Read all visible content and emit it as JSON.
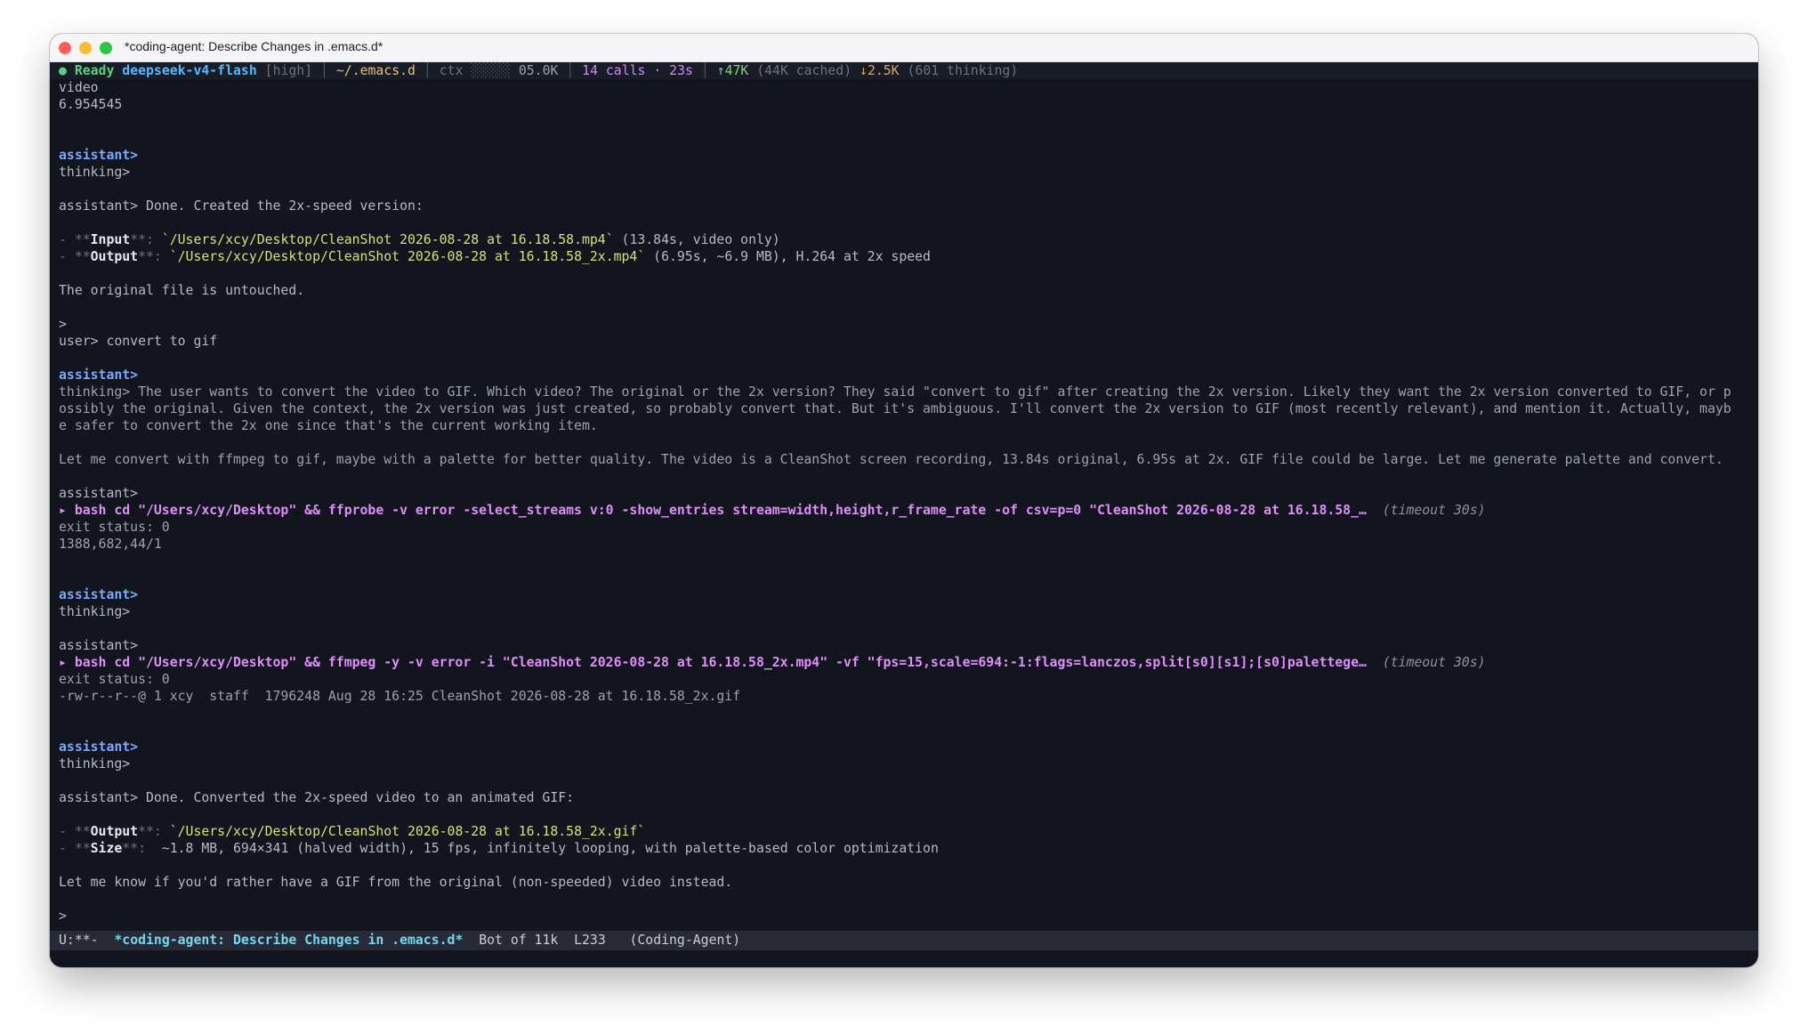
{
  "window": {
    "title": "*coding-agent: Describe Changes in .emacs.d*"
  },
  "header": {
    "status": "● Ready",
    "model": "deepseek-v4-flash",
    "effort": "[high]",
    "dir": "~/.emacs.d",
    "ctx": "ctx",
    "ctx_value": "05.0K",
    "calls": "14 calls · 23s",
    "up": "↑47K",
    "cached": "(44K cached)",
    "down": "↓2.5K",
    "thinking": "(601 thinking)"
  },
  "lines": {
    "l1": "video",
    "l2": "6.954545",
    "l5": "assistant>",
    "l6": "thinking>",
    "l8": "assistant> Done. Created the 2x-speed version:",
    "l10_a": "- **",
    "l10_b": "Input",
    "l10_c": "**: ",
    "l10_d": "`/Users/xcy/Desktop/CleanShot 2026-08-28 at 16.18.58.mp4`",
    "l10_e": " (13.84s, video only)",
    "l11_a": "- **",
    "l11_b": "Output",
    "l11_c": "**: ",
    "l11_d": "`/Users/xcy/Desktop/CleanShot 2026-08-28 at 16.18.58_2x.mp4`",
    "l11_e": " (6.95s, ~6.9 MB), H.264 at 2x speed",
    "l13": "The original file is untouched.",
    "l15": ">",
    "l16": "user> convert to gif",
    "l18": "assistant>",
    "l19": "thinking> The user wants to convert the video to GIF. Which video? The original or the 2x version? They said \"convert to gif\" after creating the 2x version. Likely they want the 2x version converted to GIF, or p",
    "l20": "ossibly the original. Given the context, the 2x version was just created, so probably convert that. But it's ambiguous. I'll convert the 2x version to GIF (most recently relevant), and mention it. Actually, mayb",
    "l21": "e safer to convert the 2x one since that's the current working item.",
    "l23": "Let me convert with ffmpeg to gif, maybe with a palette for better quality. The video is a CleanShot screen recording, 13.84s original, 6.95s at 2x. GIF file could be large. Let me generate palette and convert.",
    "l25": "assistant>",
    "l26_cmd": "▸ bash cd \"/Users/xcy/Desktop\" && ffprobe -v error -select_streams v:0 -show_entries stream=width,height,r_frame_rate -of csv=p=0 \"CleanShot 2026-08-28 at 16.18.58_…",
    "l26_t": "  (timeout 30s)",
    "l27": "exit status: 0",
    "l28": "1388,682,44/1",
    "l31": "assistant>",
    "l32": "thinking>",
    "l34": "assistant>",
    "l35_cmd": "▸ bash cd \"/Users/xcy/Desktop\" && ffmpeg -y -v error -i \"CleanShot 2026-08-28 at 16.18.58_2x.mp4\" -vf \"fps=15,scale=694:-1:flags=lanczos,split[s0][s1];[s0]palettege…",
    "l35_t": "  (timeout 30s)",
    "l36": "exit status: 0",
    "l37": "-rw-r--r--@ 1 xcy  staff  1796248 Aug 28 16:25 CleanShot 2026-08-28 at 16.18.58_2x.gif",
    "l40": "assistant>",
    "l41": "thinking>",
    "l43": "assistant> Done. Converted the 2x-speed video to an animated GIF:",
    "l45_d": "`/Users/xcy/Desktop/CleanShot 2026-08-28 at 16.18.58_2x.gif`",
    "l46_b": "Size",
    "l46_e": " ~1.8 MB, 694×341 (halved width), 15 fps, infinitely looping, with palette-based color optimization",
    "l48": "Let me know if you'd rather have a GIF from the original (non-speeded) video instead.",
    "l50": ">"
  },
  "modeline": {
    "state": "U:**-",
    "buffer": "*coding-agent: Describe Changes in .emacs.d*",
    "position": "Bot of 11k",
    "line": "L233",
    "mode": "(Coding-Agent)"
  },
  "colors": {
    "background": "#12151e",
    "user_label": "#79a8ff",
    "command": "#df8ef9",
    "path": "#d7e07a"
  }
}
